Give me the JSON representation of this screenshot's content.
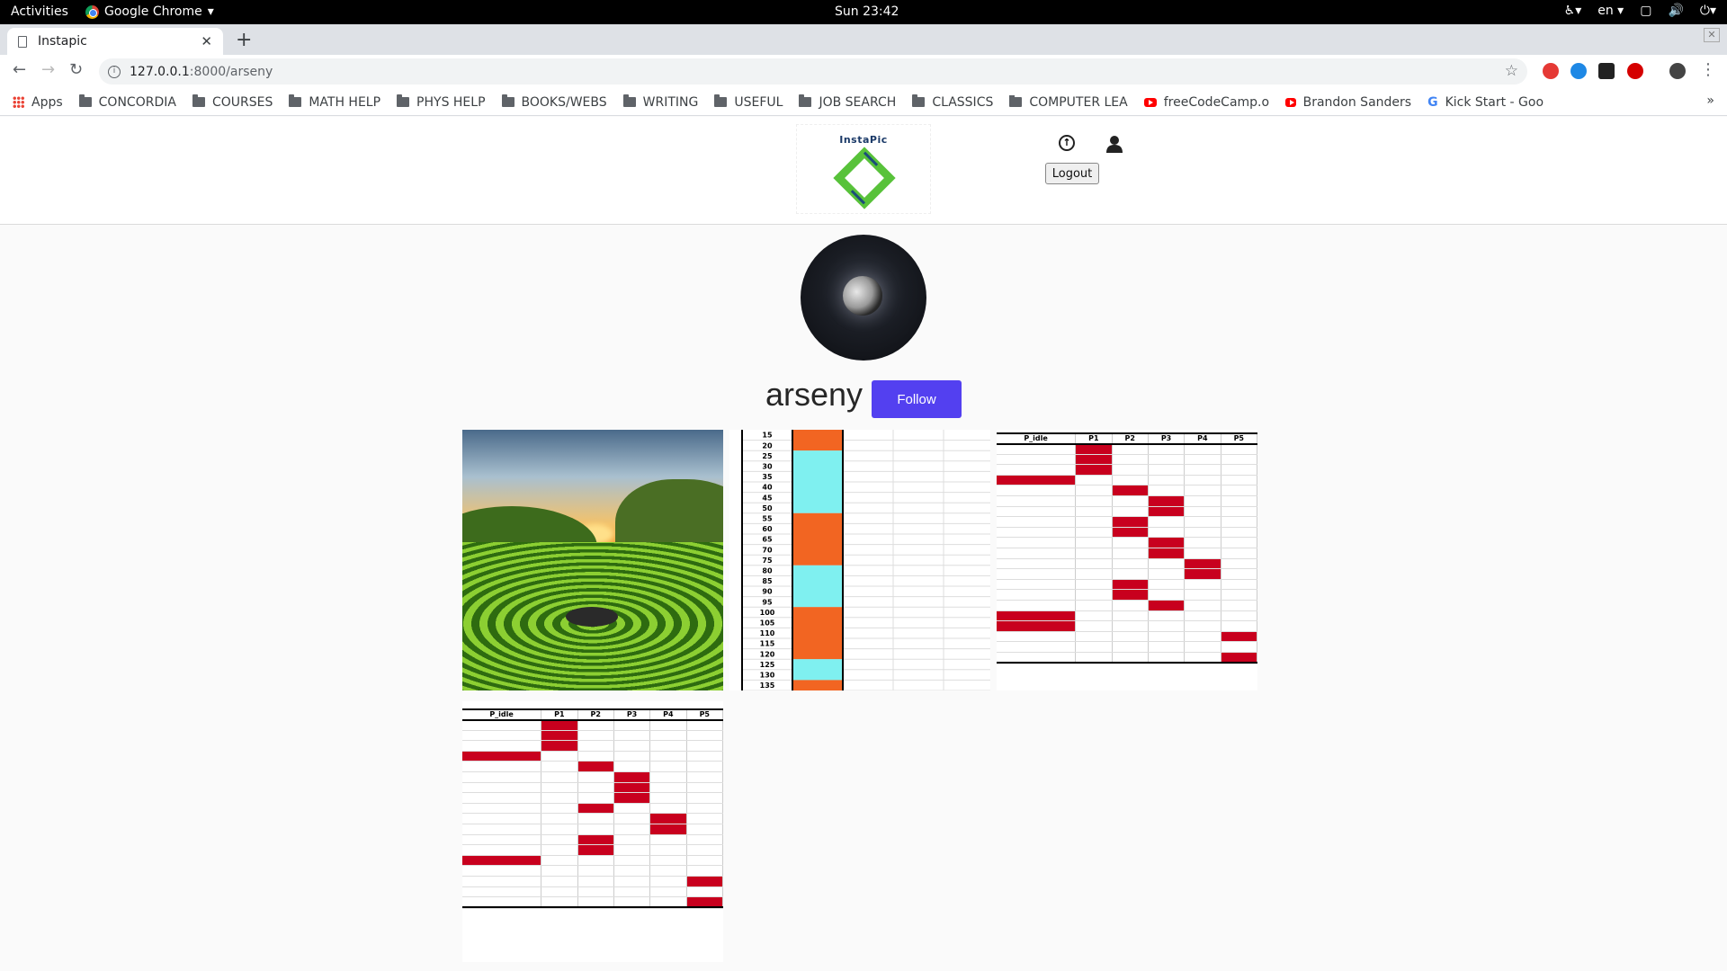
{
  "system_bar": {
    "activities": "Activities",
    "app_name": "Google Chrome",
    "clock": "Sun 23:42",
    "language": "en"
  },
  "browser": {
    "tab_title": "Instapic",
    "url_host": "127.0.0.1",
    "url_path": ":8000/arseny",
    "bookmarks": [
      {
        "label": "Apps",
        "icon": "apps-icon"
      },
      {
        "label": "CONCORDIA",
        "icon": "folder-icon"
      },
      {
        "label": "COURSES",
        "icon": "folder-icon"
      },
      {
        "label": "MATH HELP",
        "icon": "folder-icon"
      },
      {
        "label": "PHYS HELP",
        "icon": "folder-icon"
      },
      {
        "label": "BOOKS/WEBS",
        "icon": "folder-icon"
      },
      {
        "label": "WRITING",
        "icon": "folder-icon"
      },
      {
        "label": "USEFUL",
        "icon": "folder-icon"
      },
      {
        "label": "JOB SEARCH",
        "icon": "folder-icon"
      },
      {
        "label": "CLASSICS",
        "icon": "folder-icon"
      },
      {
        "label": "COMPUTER LEA",
        "icon": "folder-icon"
      },
      {
        "label": "freeCodeCamp.o",
        "icon": "youtube-icon"
      },
      {
        "label": "Brandon Sanders",
        "icon": "youtube-icon"
      },
      {
        "label": "Kick Start - Goo",
        "icon": "google-icon"
      }
    ],
    "more": "»"
  },
  "header": {
    "logo_text": "InstaPic",
    "logout_label": "Logout"
  },
  "profile": {
    "username": "arseny",
    "follow_label": "Follow"
  },
  "timeline_post": {
    "ticks": [
      "15",
      "20",
      "25",
      "30",
      "35",
      "40",
      "45",
      "50",
      "55",
      "60",
      "65",
      "70",
      "75",
      "80",
      "85",
      "90",
      "95",
      "100",
      "105",
      "110",
      "115",
      "120",
      "125",
      "130",
      "135"
    ],
    "segments": [
      {
        "color": "#f26522",
        "rows": 2
      },
      {
        "color": "#7ff0f0",
        "rows": 6
      },
      {
        "color": "#f26522",
        "rows": 5
      },
      {
        "color": "#7ff0f0",
        "rows": 4
      },
      {
        "color": "#f26522",
        "rows": 5
      },
      {
        "color": "#7ff0f0",
        "rows": 2
      },
      {
        "color": "#f26522",
        "rows": 1
      }
    ]
  },
  "schedule_headers": [
    "P_idle",
    "P1",
    "P2",
    "P3",
    "P4",
    "P5"
  ],
  "schedule_a": {
    "rows": 18,
    "cells": [
      [
        0,
        1
      ],
      [
        1,
        1
      ],
      [
        2,
        1
      ],
      [
        3,
        0
      ],
      [
        4,
        2
      ],
      [
        5,
        3
      ],
      [
        6,
        3
      ],
      [
        7,
        2
      ],
      [
        8,
        2
      ],
      [
        9,
        3
      ],
      [
        10,
        3
      ],
      [
        11,
        4
      ],
      [
        12,
        4
      ],
      [
        13,
        2
      ],
      [
        14,
        2
      ],
      [
        15,
        3
      ],
      [
        16,
        0
      ],
      [
        17,
        0
      ],
      [
        18,
        5
      ],
      [
        20,
        5
      ]
    ]
  },
  "schedule_b": {
    "rows": 18,
    "cells": [
      [
        0,
        1
      ],
      [
        1,
        1
      ],
      [
        2,
        1
      ],
      [
        3,
        0
      ],
      [
        4,
        2
      ],
      [
        5,
        3
      ],
      [
        6,
        3
      ],
      [
        7,
        3
      ],
      [
        8,
        2
      ],
      [
        9,
        4
      ],
      [
        10,
        4
      ],
      [
        11,
        2
      ],
      [
        12,
        2
      ],
      [
        13,
        0
      ],
      [
        15,
        5
      ],
      [
        17,
        5
      ]
    ]
  }
}
